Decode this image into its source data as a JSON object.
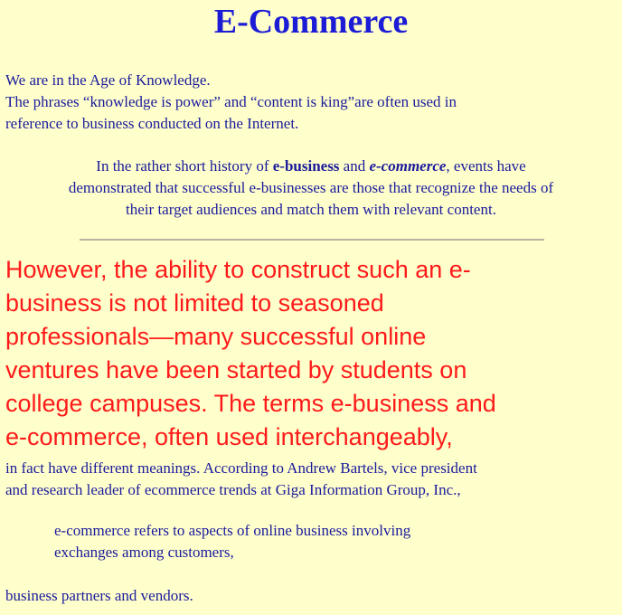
{
  "title": "E-Commerce",
  "intro": {
    "lines": [
      "We are in the Age of Knowledge.",
      "The phrases “knowledge is power” and “content is king”are often used in",
      "reference to business conducted on the Internet."
    ]
  },
  "history": {
    "line1_before": "In the rather short history of ",
    "term_ebusiness": "e-business",
    "and": " and ",
    "term_ecommerce": "e-commerce",
    "line1_after": ", events have",
    "line2": "demonstrated that successful e-businesses are those that recognize the needs of",
    "line3": "their target audiences and match them with relevant content."
  },
  "highlight": {
    "lines": [
      "However, the ability to construct such an e-",
      "business is not limited to seasoned",
      "professionals—many successful online",
      "ventures have been started by students on",
      "college campuses. The terms e-business and",
      "e-commerce, often used interchangeably,"
    ]
  },
  "continuation": {
    "lines": [
      "in fact have different meanings. According to Andrew Bartels, vice president",
      "and research leader of ecommerce trends at Giga Information Group, Inc.,"
    ]
  },
  "quote": {
    "lines": [
      "e-commerce refers to aspects of online business involving",
      "exchanges among customers,"
    ]
  },
  "closing": "business partners and vendors.",
  "colors": {
    "background": "#ffffcc",
    "body_text": "#1a1a9c",
    "title": "#1c1cd6",
    "highlight": "#ff1a1a"
  }
}
